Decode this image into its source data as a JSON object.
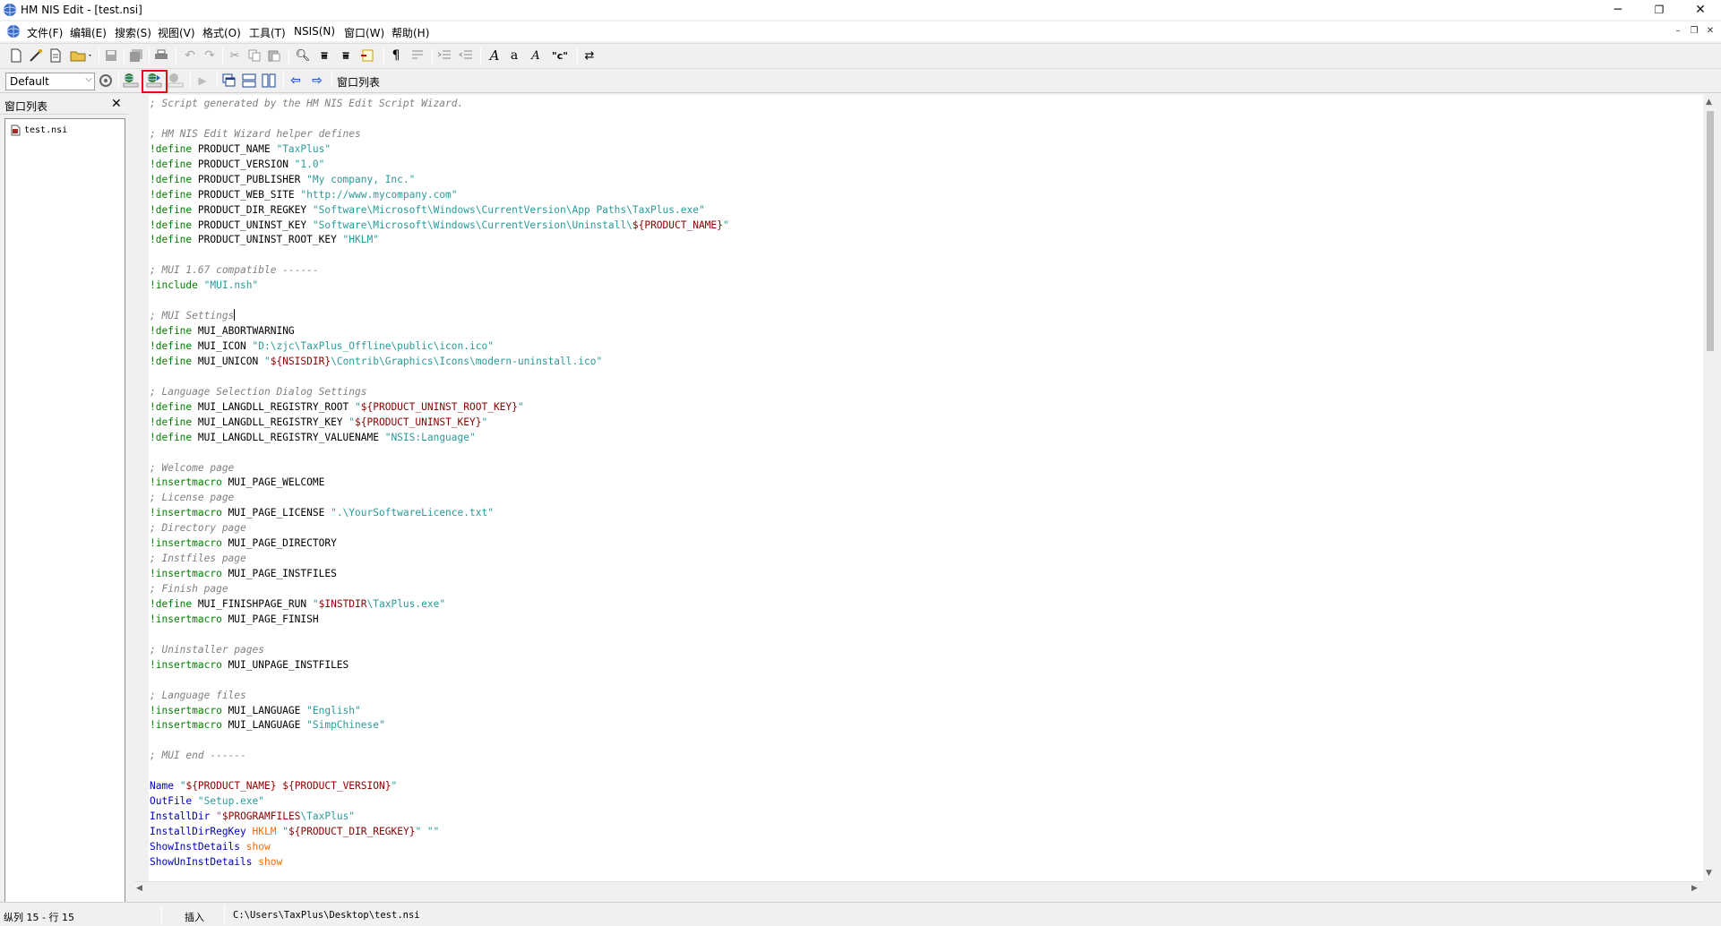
{
  "window": {
    "title": "HM NIS Edit - [test.nsi]",
    "minimize": "─",
    "restore": "❐",
    "close": "✕"
  },
  "menu": [
    "文件(F)",
    "编辑(E)",
    "搜索(S)",
    "视图(V)",
    "格式(O)",
    "工具(T)",
    "NSIS(N)",
    "窗口(W)",
    "帮助(H)"
  ],
  "mdi_controls": [
    "–",
    "❐",
    "✕"
  ],
  "toolbar": {
    "config_select": "Default",
    "window_list_label": "窗口列表",
    "text_tools": [
      "A",
      "a",
      "A",
      "\"c\""
    ]
  },
  "panel": {
    "title": "窗口列表",
    "close": "✕",
    "files": [
      "test.nsi"
    ]
  },
  "editor": {
    "lines": [
      [
        [
          "cm",
          "; Script generated by the HM NIS Edit Script Wizard."
        ]
      ],
      [],
      [
        [
          "cm",
          "; HM NIS Edit Wizard helper defines"
        ]
      ],
      [
        [
          "pp",
          "!define"
        ],
        [
          "",
          " PRODUCT_NAME "
        ],
        [
          "st",
          "\"TaxPlus\""
        ]
      ],
      [
        [
          "pp",
          "!define"
        ],
        [
          "",
          " PRODUCT_VERSION "
        ],
        [
          "st",
          "\"1.0\""
        ]
      ],
      [
        [
          "pp",
          "!define"
        ],
        [
          "",
          " PRODUCT_PUBLISHER "
        ],
        [
          "st",
          "\"My company, Inc.\""
        ]
      ],
      [
        [
          "pp",
          "!define"
        ],
        [
          "",
          " PRODUCT_WEB_SITE "
        ],
        [
          "st",
          "\"http://www.mycompany.com\""
        ]
      ],
      [
        [
          "pp",
          "!define"
        ],
        [
          "",
          " PRODUCT_DIR_REGKEY "
        ],
        [
          "st",
          "\"Software\\Microsoft\\Windows\\CurrentVersion\\App Paths\\TaxPlus.exe\""
        ]
      ],
      [
        [
          "pp",
          "!define"
        ],
        [
          "",
          " PRODUCT_UNINST_KEY "
        ],
        [
          "st",
          "\"Software\\Microsoft\\Windows\\CurrentVersion\\Uninstall\\"
        ],
        [
          "vr",
          "${PRODUCT_NAME}"
        ],
        [
          "st",
          "\""
        ]
      ],
      [
        [
          "pp",
          "!define"
        ],
        [
          "",
          " PRODUCT_UNINST_ROOT_KEY "
        ],
        [
          "st",
          "\"HKLM\""
        ]
      ],
      [],
      [
        [
          "cm",
          "; MUI 1.67 compatible ------"
        ]
      ],
      [
        [
          "pp",
          "!include"
        ],
        [
          "",
          " "
        ],
        [
          "st",
          "\"MUI.nsh\""
        ]
      ],
      [],
      [
        [
          "cm",
          "; MUI Settings"
        ],
        [
          "caret",
          ""
        ]
      ],
      [
        [
          "pp",
          "!define"
        ],
        [
          "",
          " MUI_ABORTWARNING"
        ]
      ],
      [
        [
          "pp",
          "!define"
        ],
        [
          "",
          " MUI_ICON "
        ],
        [
          "st",
          "\"D:\\zjc\\TaxPlus_Offline\\public\\icon.ico\""
        ]
      ],
      [
        [
          "pp",
          "!define"
        ],
        [
          "",
          " MUI_UNICON "
        ],
        [
          "st",
          "\""
        ],
        [
          "vr",
          "${NSISDIR}"
        ],
        [
          "st",
          "\\Contrib\\Graphics\\Icons\\modern-uninstall.ico\""
        ]
      ],
      [],
      [
        [
          "cm",
          "; Language Selection Dialog Settings"
        ]
      ],
      [
        [
          "pp",
          "!define"
        ],
        [
          "",
          " MUI_LANGDLL_REGISTRY_ROOT "
        ],
        [
          "st",
          "\""
        ],
        [
          "vr",
          "${PRODUCT_UNINST_ROOT_KEY}"
        ],
        [
          "st",
          "\""
        ]
      ],
      [
        [
          "pp",
          "!define"
        ],
        [
          "",
          " MUI_LANGDLL_REGISTRY_KEY "
        ],
        [
          "st",
          "\""
        ],
        [
          "vr",
          "${PRODUCT_UNINST_KEY}"
        ],
        [
          "st",
          "\""
        ]
      ],
      [
        [
          "pp",
          "!define"
        ],
        [
          "",
          " MUI_LANGDLL_REGISTRY_VALUENAME "
        ],
        [
          "st",
          "\"NSIS:Language\""
        ]
      ],
      [],
      [
        [
          "cm",
          "; Welcome page"
        ]
      ],
      [
        [
          "pp",
          "!insertmacro"
        ],
        [
          "",
          " MUI_PAGE_WELCOME"
        ]
      ],
      [
        [
          "cm",
          "; License page"
        ]
      ],
      [
        [
          "pp",
          "!insertmacro"
        ],
        [
          "",
          " MUI_PAGE_LICENSE "
        ],
        [
          "st",
          "\".\\YourSoftwareLicence.txt\""
        ]
      ],
      [
        [
          "cm",
          "; Directory page"
        ]
      ],
      [
        [
          "pp",
          "!insertmacro"
        ],
        [
          "",
          " MUI_PAGE_DIRECTORY"
        ]
      ],
      [
        [
          "cm",
          "; Instfiles page"
        ]
      ],
      [
        [
          "pp",
          "!insertmacro"
        ],
        [
          "",
          " MUI_PAGE_INSTFILES"
        ]
      ],
      [
        [
          "cm",
          "; Finish page"
        ]
      ],
      [
        [
          "pp",
          "!define"
        ],
        [
          "",
          " MUI_FINISHPAGE_RUN "
        ],
        [
          "st",
          "\""
        ],
        [
          "vr",
          "$INSTDIR"
        ],
        [
          "st",
          "\\TaxPlus.exe\""
        ]
      ],
      [
        [
          "pp",
          "!insertmacro"
        ],
        [
          "",
          " MUI_PAGE_FINISH"
        ]
      ],
      [],
      [
        [
          "cm",
          "; Uninstaller pages"
        ]
      ],
      [
        [
          "pp",
          "!insertmacro"
        ],
        [
          "",
          " MUI_UNPAGE_INSTFILES"
        ]
      ],
      [],
      [
        [
          "cm",
          "; Language files"
        ]
      ],
      [
        [
          "pp",
          "!insertmacro"
        ],
        [
          "",
          " MUI_LANGUAGE "
        ],
        [
          "st",
          "\"English\""
        ]
      ],
      [
        [
          "pp",
          "!insertmacro"
        ],
        [
          "",
          " MUI_LANGUAGE "
        ],
        [
          "st",
          "\"SimpChinese\""
        ]
      ],
      [],
      [
        [
          "cm",
          "; MUI end ------"
        ]
      ],
      [],
      [
        [
          "kw",
          "Name"
        ],
        [
          "",
          " "
        ],
        [
          "st",
          "\""
        ],
        [
          "vr",
          "${PRODUCT_NAME} ${PRODUCT_VERSION}"
        ],
        [
          "st",
          "\""
        ]
      ],
      [
        [
          "kw",
          "OutFile"
        ],
        [
          "",
          " "
        ],
        [
          "st",
          "\"Setup.exe\""
        ]
      ],
      [
        [
          "kw",
          "InstallDir"
        ],
        [
          "",
          " "
        ],
        [
          "st",
          "\""
        ],
        [
          "vr",
          "$PROGRAMFILES"
        ],
        [
          "st",
          "\\TaxPlus\""
        ]
      ],
      [
        [
          "kw",
          "InstallDirRegKey"
        ],
        [
          "",
          " "
        ],
        [
          "at",
          "HKLM"
        ],
        [
          "",
          " "
        ],
        [
          "st",
          "\""
        ],
        [
          "vr",
          "${PRODUCT_DIR_REGKEY}"
        ],
        [
          "st",
          "\" \"\""
        ]
      ],
      [
        [
          "kw",
          "ShowInstDetails"
        ],
        [
          "",
          " "
        ],
        [
          "at",
          "show"
        ]
      ],
      [
        [
          "kw",
          "ShowUnInstDetails"
        ],
        [
          "",
          " "
        ],
        [
          "at",
          "show"
        ]
      ]
    ]
  },
  "status": {
    "position": "纵列 15 - 行 15",
    "mode": "插入",
    "path": "C:\\Users\\TaxPlus\\Desktop\\test.nsi"
  },
  "colors": {
    "comment": "#808080",
    "directive": "#008000",
    "string": "#2a9a9a",
    "variable": "#8b0000",
    "keyword": "#0000c0",
    "attribute": "#ff6a00",
    "highlight": "#e01010"
  }
}
